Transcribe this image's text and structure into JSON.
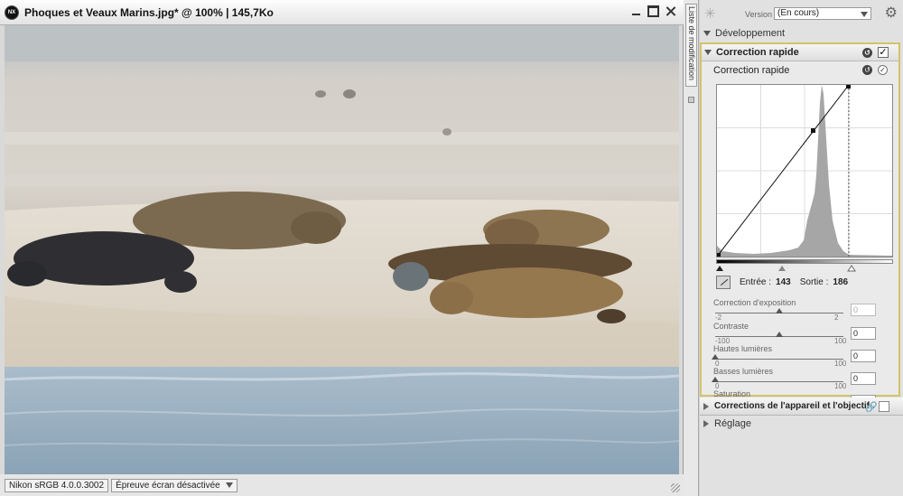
{
  "window": {
    "title": "Phoques et Veaux Marins.jpg* @ 100% | 145,7Ko",
    "logo_text": "NX"
  },
  "status": {
    "profile": "Nikon sRGB 4.0.0.3002",
    "proof": "Épreuve écran désactivée"
  },
  "side_tab": "Liste de modification",
  "panel": {
    "version_label": "Version",
    "version_value": "(En cours)",
    "development_label": "Développement",
    "quick_fix_title": "Correction rapide",
    "quick_fix_sub": "Correction rapide",
    "input_label": "Entrée :",
    "input_value": "143",
    "output_label": "Sortie :",
    "output_value": "186",
    "sliders": [
      {
        "label": "Correction d'exposition",
        "min": "-2",
        "max": "2",
        "value": "0",
        "level": 0.5,
        "disabled": true
      },
      {
        "label": "Contraste",
        "min": "-100",
        "max": "100",
        "value": "0",
        "level": 0.5,
        "disabled": false
      },
      {
        "label": "Hautes lumières",
        "min": "0",
        "max": "100",
        "value": "0",
        "level": 0.0,
        "disabled": false
      },
      {
        "label": "Basses lumières",
        "min": "0",
        "max": "100",
        "value": "0",
        "level": 0.0,
        "disabled": false
      },
      {
        "label": "Saturation",
        "min": "-100",
        "max": "100",
        "value": "0",
        "level": 0.5,
        "disabled": false
      }
    ],
    "lens_section": "Corrections de l'appareil et l'objectif",
    "adjust_section": "Réglage"
  },
  "colors": {
    "qc_border": "#d2c36a",
    "histogram": "#a6a6a6"
  }
}
